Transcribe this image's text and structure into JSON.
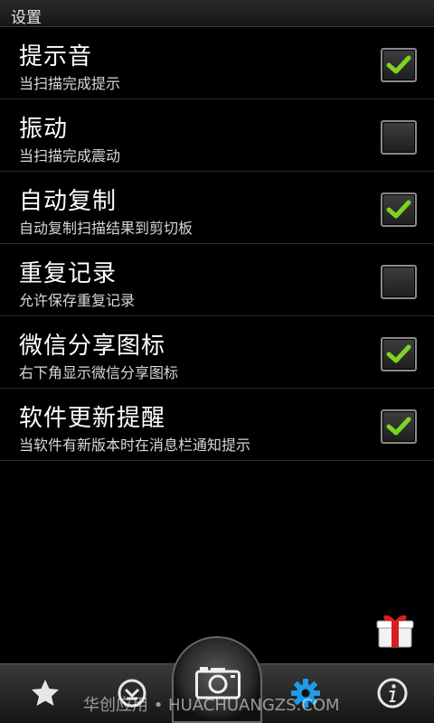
{
  "titlebar": {
    "title": "设置"
  },
  "settings": [
    {
      "label": "提示音",
      "desc": "当扫描完成提示",
      "checked": true
    },
    {
      "label": "振动",
      "desc": "当扫描完成震动",
      "checked": false
    },
    {
      "label": "自动复制",
      "desc": "自动复制扫描结果到剪切板",
      "checked": true
    },
    {
      "label": "重复记录",
      "desc": "允许保存重复记录",
      "checked": false
    },
    {
      "label": "微信分享图标",
      "desc": "右下角显示微信分享图标",
      "checked": true
    },
    {
      "label": "软件更新提醒",
      "desc": "当软件有新版本时在消息栏通知提示",
      "checked": true
    }
  ],
  "bottom_nav": {
    "items": [
      {
        "icon": "star-icon"
      },
      {
        "icon": "history-icon"
      },
      {
        "icon": "camera-icon"
      },
      {
        "icon": "gear-icon",
        "active": true
      },
      {
        "icon": "info-icon"
      }
    ]
  },
  "floating": {
    "icon": "gift-icon"
  },
  "watermark": {
    "text": "华创应用 • HUACHUANGZS.COM"
  },
  "colors": {
    "check_green": "#7ed321",
    "active_blue": "#1e9be8",
    "gift_red": "#d81e1e"
  }
}
